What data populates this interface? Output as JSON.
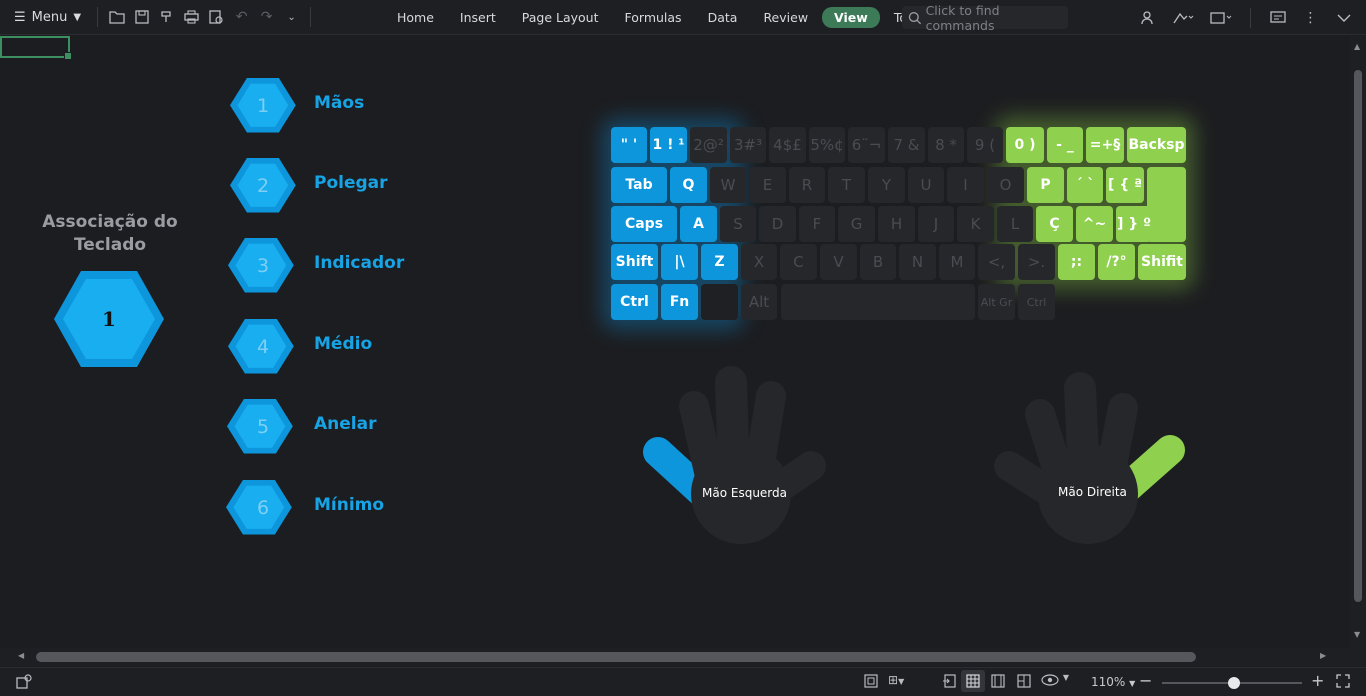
{
  "toolbar": {
    "menu_label": "Menu",
    "tabs": [
      "Home",
      "Insert",
      "Page Layout",
      "Formulas",
      "Data",
      "Review",
      "View",
      "Tools"
    ],
    "active_tab": "View",
    "search_placeholder": "Click to find commands"
  },
  "sheet": {
    "association_title": "Associação do Teclado",
    "selected_number": "1",
    "fingers": [
      {
        "num": "1",
        "label": "Mãos"
      },
      {
        "num": "2",
        "label": "Polegar"
      },
      {
        "num": "3",
        "label": "Indicador"
      },
      {
        "num": "4",
        "label": "Médio"
      },
      {
        "num": "5",
        "label": "Anelar"
      },
      {
        "num": "6",
        "label": "Mínimo"
      }
    ],
    "keyboard": {
      "row1": [
        "\" '",
        "1 ! ¹",
        "2@²",
        "3#³",
        "4$£",
        "5%¢",
        "6¨¬",
        "7 &",
        "8 *",
        "9 (",
        "0 )",
        "- _",
        "=+§",
        "Backsp"
      ],
      "row2": [
        "Tab",
        "Q",
        "W",
        "E",
        "R",
        "T",
        "Y",
        "U",
        "I",
        "O",
        "P",
        "´ `",
        "[ { ª"
      ],
      "row3": [
        "Caps",
        "A",
        "S",
        "D",
        "F",
        "G",
        "H",
        "J",
        "K",
        "L",
        "Ç",
        "^~",
        "] } º"
      ],
      "row4": [
        "Shift",
        "|\\",
        "Z",
        "X",
        "C",
        "V",
        "B",
        "N",
        "M",
        "<,",
        ">.",
        ";:",
        "/?°",
        "Shifit"
      ],
      "row5": [
        "Ctrl",
        "Fn",
        "",
        "Alt",
        "",
        "Alt Gr",
        "Ctrl"
      ]
    },
    "left_hand_label": "Mão Esquerda",
    "right_hand_label": "Mão Direita"
  },
  "status": {
    "zoom": "110%",
    "zoom_level": 0.52
  },
  "colors": {
    "blue": "#0d96db",
    "green": "#8fd04e",
    "accent": "#3d7a58"
  }
}
